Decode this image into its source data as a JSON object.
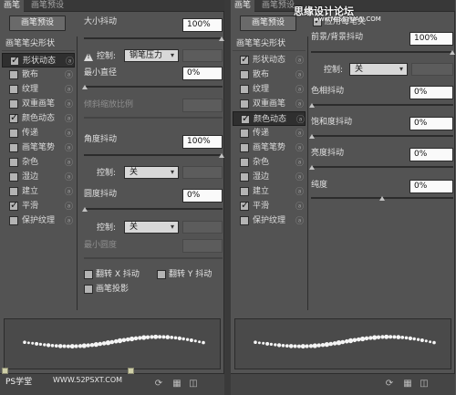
{
  "left_panel": {
    "tabs": [
      "画笔",
      "画笔预设"
    ],
    "preset_button": "画笔预设",
    "list_header": "画笔笔尖形状",
    "items": [
      {
        "label": "形状动态",
        "checked": true,
        "selected": true
      },
      {
        "label": "散布",
        "checked": false,
        "selected": false
      },
      {
        "label": "纹理",
        "checked": false,
        "selected": false
      },
      {
        "label": "双重画笔",
        "checked": false,
        "selected": false
      },
      {
        "label": "颜色动态",
        "checked": true,
        "selected": false
      },
      {
        "label": "传递",
        "checked": false,
        "selected": false
      },
      {
        "label": "画笔笔势",
        "checked": false,
        "selected": false
      },
      {
        "label": "杂色",
        "checked": false,
        "selected": false
      },
      {
        "label": "湿边",
        "checked": false,
        "selected": false
      },
      {
        "label": "建立",
        "checked": false,
        "selected": false
      },
      {
        "label": "平滑",
        "checked": true,
        "selected": false
      },
      {
        "label": "保护纹理",
        "checked": false,
        "selected": false
      }
    ],
    "size_jitter_label": "大小抖动",
    "size_jitter_value": "100%",
    "control_label": "控制:",
    "control1_value": "钢笔压力",
    "min_diameter_label": "最小直径",
    "min_diameter_value": "0%",
    "tilt_scale_label": "倾斜缩放比例",
    "angle_jitter_label": "角度抖动",
    "angle_jitter_value": "100%",
    "control2_value": "关",
    "roundness_jitter_label": "圆度抖动",
    "roundness_jitter_value": "0%",
    "control3_value": "关",
    "min_roundness_label": "最小圆度",
    "flip_x_label": "翻转 X 抖动",
    "flip_y_label": "翻转 Y 抖动",
    "brush_projection_label": "画笔投影",
    "watermark": "PS学堂",
    "watermark_url": "WWW.52PSXT.COM"
  },
  "right_panel": {
    "tabs": [
      "画笔",
      "画笔预设"
    ],
    "preset_button": "画笔预设",
    "list_header": "画笔笔尖形状",
    "items": [
      {
        "label": "形状动态",
        "checked": true,
        "selected": false
      },
      {
        "label": "散布",
        "checked": false,
        "selected": false
      },
      {
        "label": "纹理",
        "checked": false,
        "selected": false
      },
      {
        "label": "双重画笔",
        "checked": false,
        "selected": false
      },
      {
        "label": "颜色动态",
        "checked": true,
        "selected": true
      },
      {
        "label": "传递",
        "checked": false,
        "selected": false
      },
      {
        "label": "画笔笔势",
        "checked": false,
        "selected": false
      },
      {
        "label": "杂色",
        "checked": false,
        "selected": false
      },
      {
        "label": "湿边",
        "checked": false,
        "selected": false
      },
      {
        "label": "建立",
        "checked": false,
        "selected": false
      },
      {
        "label": "平滑",
        "checked": true,
        "selected": false
      },
      {
        "label": "保护纹理",
        "checked": false,
        "selected": false
      }
    ],
    "apply_per_tip_label": "应用每笔尖",
    "fg_bg_jitter_label": "前景/背景抖动",
    "fg_bg_jitter_value": "100%",
    "control_label": "控制:",
    "control_value": "关",
    "hue_jitter_label": "色相抖动",
    "hue_jitter_value": "0%",
    "saturation_jitter_label": "饱和度抖动",
    "saturation_jitter_value": "0%",
    "brightness_jitter_label": "亮度抖动",
    "brightness_jitter_value": "0%",
    "purity_label": "纯度",
    "purity_value": "0%",
    "watermark_title": "思缘设计论坛",
    "watermark_url": "www.MISSYUAN.COM"
  }
}
